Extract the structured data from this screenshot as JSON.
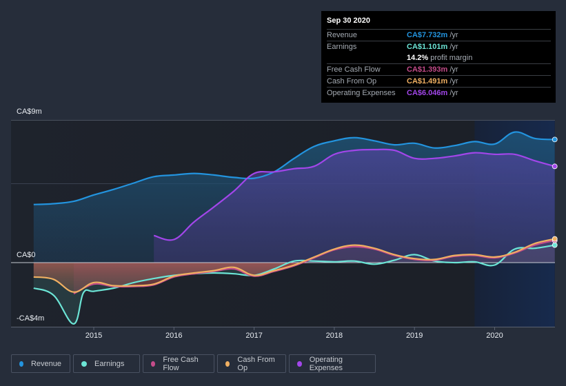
{
  "tooltip": {
    "date": "Sep 30 2020",
    "rows": [
      {
        "label": "Revenue",
        "value": "CA$7.732m",
        "unit": "/yr",
        "color": "#2394df"
      },
      {
        "label": "Earnings",
        "value": "CA$1.101m",
        "unit": "/yr",
        "color": "#6ce5d6"
      },
      {
        "label": "",
        "value": "14.2%",
        "unit": "profit margin",
        "color": "#ffffff"
      },
      {
        "label": "Free Cash Flow",
        "value": "CA$1.393m",
        "unit": "/yr",
        "color": "#c44c8a"
      },
      {
        "label": "Cash From Op",
        "value": "CA$1.491m",
        "unit": "/yr",
        "color": "#f0b062"
      },
      {
        "label": "Operating Expenses",
        "value": "CA$6.046m",
        "unit": "/yr",
        "color": "#a246ea"
      }
    ]
  },
  "legend": [
    {
      "label": "Revenue",
      "color": "#2394df"
    },
    {
      "label": "Earnings",
      "color": "#6ce5d6"
    },
    {
      "label": "Free Cash Flow",
      "color": "#c44c8a"
    },
    {
      "label": "Cash From Op",
      "color": "#f0b062"
    },
    {
      "label": "Operating Expenses",
      "color": "#a246ea"
    }
  ],
  "chart_data": {
    "type": "line",
    "title": "",
    "xlabel": "",
    "ylabel": "",
    "currency_unit": "CA$ millions",
    "y_tick_labels": [
      "CA$9m",
      "CA$0",
      "-CA$4m"
    ],
    "y_ticks": [
      9,
      0,
      -4
    ],
    "ylim": [
      -4,
      9
    ],
    "x_tick_labels": [
      "2015",
      "2016",
      "2017",
      "2018",
      "2019",
      "2020"
    ],
    "x_ticks": [
      2015,
      2016,
      2017,
      2018,
      2019,
      2020
    ],
    "xlim": [
      2014.0,
      2020.75
    ],
    "highlight_start": 2019.75,
    "grid": true,
    "legend_position": "bottom",
    "series": [
      {
        "name": "Revenue",
        "color": "#2394df",
        "x": [
          2014.25,
          2014.5,
          2014.75,
          2015.0,
          2015.25,
          2015.5,
          2015.75,
          2016.0,
          2016.25,
          2016.5,
          2016.75,
          2017.0,
          2017.25,
          2017.5,
          2017.75,
          2018.0,
          2018.25,
          2018.5,
          2018.75,
          2019.0,
          2019.25,
          2019.5,
          2019.75,
          2020.0,
          2020.25,
          2020.5,
          2020.75
        ],
        "values": [
          3.65,
          3.7,
          3.85,
          4.25,
          4.6,
          5.0,
          5.4,
          5.5,
          5.6,
          5.5,
          5.35,
          5.3,
          5.7,
          6.55,
          7.3,
          7.65,
          7.85,
          7.65,
          7.4,
          7.5,
          7.2,
          7.35,
          7.6,
          7.45,
          8.2,
          7.8,
          7.732
        ]
      },
      {
        "name": "Earnings",
        "color": "#6ce5d6",
        "x": [
          2014.25,
          2014.5,
          2014.75,
          2014.87,
          2015.0,
          2015.25,
          2015.5,
          2015.75,
          2016.0,
          2016.25,
          2016.5,
          2016.75,
          2017.0,
          2017.25,
          2017.5,
          2017.75,
          2018.0,
          2018.25,
          2018.5,
          2018.75,
          2019.0,
          2019.25,
          2019.5,
          2019.75,
          2020.0,
          2020.25,
          2020.5,
          2020.75
        ],
        "values": [
          -1.6,
          -2.05,
          -3.85,
          -1.9,
          -1.8,
          -1.6,
          -1.25,
          -1.0,
          -0.8,
          -0.7,
          -0.65,
          -0.7,
          -0.8,
          -0.4,
          0.1,
          0.1,
          0.05,
          0.1,
          -0.1,
          0.15,
          0.5,
          0.1,
          0.0,
          0.05,
          -0.15,
          0.85,
          0.9,
          1.101
        ]
      },
      {
        "name": "Free Cash Flow",
        "color": "#c44c8a",
        "x": [
          2014.75,
          2015.0,
          2015.25,
          2015.5,
          2015.75,
          2016.0,
          2016.25,
          2016.5,
          2016.75,
          2017.0,
          2017.25,
          2017.5,
          2017.75,
          2018.0,
          2018.25,
          2018.5,
          2018.75,
          2019.0,
          2019.25,
          2019.5,
          2019.75,
          2020.0,
          2020.25,
          2020.5,
          2020.75
        ],
        "values": [
          -1.95,
          -1.35,
          -1.5,
          -1.5,
          -1.4,
          -0.9,
          -0.7,
          -0.55,
          -0.4,
          -0.85,
          -0.55,
          -0.2,
          0.3,
          0.8,
          1.0,
          0.85,
          0.45,
          0.2,
          0.15,
          0.4,
          0.45,
          0.3,
          0.6,
          1.1,
          1.393
        ]
      },
      {
        "name": "Cash From Op",
        "color": "#f0b062",
        "x": [
          2014.25,
          2014.5,
          2014.75,
          2015.0,
          2015.25,
          2015.5,
          2015.75,
          2016.0,
          2016.25,
          2016.5,
          2016.75,
          2017.0,
          2017.25,
          2017.5,
          2017.75,
          2018.0,
          2018.25,
          2018.5,
          2018.75,
          2019.0,
          2019.25,
          2019.5,
          2019.75,
          2020.0,
          2020.25,
          2020.5,
          2020.75
        ],
        "values": [
          -0.9,
          -1.05,
          -1.85,
          -1.25,
          -1.45,
          -1.45,
          -1.35,
          -0.85,
          -0.65,
          -0.5,
          -0.3,
          -0.8,
          -0.5,
          -0.15,
          0.35,
          0.85,
          1.1,
          0.9,
          0.5,
          0.25,
          0.2,
          0.45,
          0.5,
          0.35,
          0.65,
          1.2,
          1.491
        ]
      },
      {
        "name": "Operating Expenses",
        "color": "#a246ea",
        "x": [
          2015.75,
          2016.0,
          2016.25,
          2016.5,
          2016.75,
          2017.0,
          2017.25,
          2017.5,
          2017.75,
          2018.0,
          2018.25,
          2018.5,
          2018.75,
          2019.0,
          2019.25,
          2019.5,
          2019.75,
          2020.0,
          2020.25,
          2020.5,
          2020.75
        ],
        "values": [
          1.7,
          1.45,
          2.55,
          3.5,
          4.5,
          5.6,
          5.7,
          5.9,
          6.05,
          6.8,
          7.05,
          7.1,
          7.05,
          6.55,
          6.55,
          6.7,
          6.9,
          6.8,
          6.8,
          6.4,
          6.046
        ]
      }
    ]
  }
}
